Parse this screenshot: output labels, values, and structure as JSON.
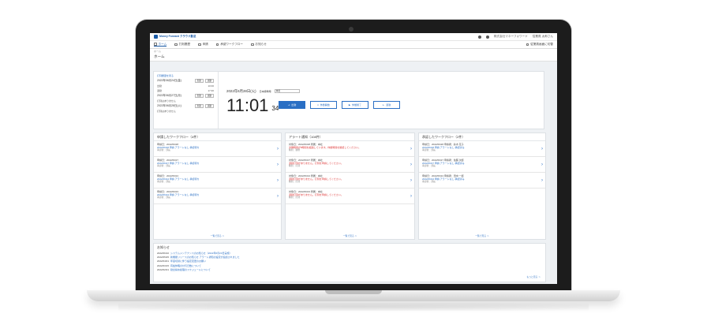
{
  "header": {
    "logo_text": "Money Forward クラウド勤怠",
    "company": "株式会社マネーフォワード",
    "user": "従業員 太郎さん"
  },
  "nav": {
    "items": [
      {
        "label": "ホーム"
      },
      {
        "label": "打刻履歴"
      },
      {
        "label": "申請"
      },
      {
        "label": "承認ワークフロー"
      },
      {
        "label": "お知らせ"
      }
    ],
    "right_label": "従業員画面に切替"
  },
  "breadcrumb": "ホーム",
  "page_title": "ホーム",
  "attendance": {
    "heading": "打刻履歴を見る",
    "rows": [
      {
        "date": "2022年06月24日(金)",
        "btn1": "出勤",
        "btn2": "退勤"
      },
      {
        "date": "出勤",
        "btn1": "10:00",
        "btn2": ""
      },
      {
        "date": "退勤",
        "btn1": "17:30",
        "btn2": ""
      },
      {
        "date": "2022年06月27日(月)",
        "btn1": "出勤",
        "btn2": "退勤"
      },
      {
        "date": "打刻はありません",
        "btn1": "",
        "btn2": ""
      },
      {
        "date": "2022年06月28日(火)",
        "btn1": "出勤",
        "btn2": "退勤"
      },
      {
        "date": "打刻はありません",
        "btn1": "",
        "btn2": ""
      }
    ],
    "date_label": "2022年6月28日(火)",
    "tz_label": "日本標準時",
    "select_value": "本社",
    "clock_hm": "11:01",
    "clock_s": "34",
    "actions": [
      {
        "label": "出勤"
      },
      {
        "label": "休憩開始"
      },
      {
        "label": "休憩終了"
      },
      {
        "label": "退勤"
      }
    ]
  },
  "workflow_requests": {
    "title": "申請したワークフロー（4件）",
    "items": [
      {
        "line1": "申請日：2022/06/28",
        "line2": "2022/06/28 申請 アラートなし 承認待ち",
        "line3": "承認者：部長"
      },
      {
        "line1": "申請日：2022/06/27",
        "line2": "2022/06/27 申請 アラートなし 承認待ち",
        "line3": "承認者：部長"
      },
      {
        "line1": "申請日：2022/06/24",
        "line2": "2022/06/24 申請 アラートなし 承認待ち",
        "line3": "承認者：部長"
      },
      {
        "line1": "申請日：2022/06/23",
        "line2": "2022/06/23 申請 アラートなし 承認待ち",
        "line3": "承認者：部長"
      }
    ],
    "more": "一覧で見る ＞"
  },
  "alerts": {
    "title": "アラート通知（108件）",
    "items": [
      {
        "line1": "対象日：2022/06/28 所属：本社",
        "msg": "労働時間が8時間を超過しています。休憩時間を確認してください。",
        "line3": "種別：勤務"
      },
      {
        "line1": "対象日：2022/06/27 所属：本社",
        "msg": "退勤打刻がありません。打刻を申請してください。",
        "line3": "種別：打刻"
      },
      {
        "line1": "対象日：2022/06/24 所属：本社",
        "msg": "退勤打刻がありません。打刻を申請してください。",
        "line3": "種別：打刻"
      },
      {
        "line1": "対象日：2022/06/23 所属：本社",
        "msg": "退勤打刻がありません。打刻を申請してください。",
        "line3": "種別：打刻"
      }
    ],
    "more": "一覧で見る ＞"
  },
  "workflow_approvals": {
    "title": "承認したワークフロー（2件）",
    "items": [
      {
        "line1": "申請日：2022/06/28 申請者：鈴木 花子",
        "line2": "2022/06/28 申請 アラートなし 承認済み",
        "line3": "承認者：部長"
      },
      {
        "line1": "申請日：2022/06/27 申請者：佐藤 次郎",
        "line2": "2022/06/27 申請 アラートなし 承認済み",
        "line3": "承認者：部長"
      },
      {
        "line1": "申請日：2022/06/24 申請者：田中 一郎",
        "line2": "2022/06/24 申請 アラートなし 承認済み",
        "line3": "承認者：部長"
      }
    ],
    "more": "一覧で見る ＞"
  },
  "notices": {
    "title": "お知らせ",
    "items": [
      {
        "date": "2022/06/10",
        "text": "システムメンテナンスのお知らせ（2022年6月20日実施）"
      },
      {
        "date": "2022/05/25",
        "text": "新機能リリースのお知らせ アラート通知の設定が追加されました"
      },
      {
        "date": "2022/04/01",
        "text": "年度切替に伴う設定変更のお願い"
      },
      {
        "date": "2022/03/15",
        "text": "有給休暇の付与日数について"
      },
      {
        "date": "2022/02/01",
        "text": "勤怠締め処理のスケジュールについて"
      }
    ],
    "more": "もっと見る ＞"
  }
}
